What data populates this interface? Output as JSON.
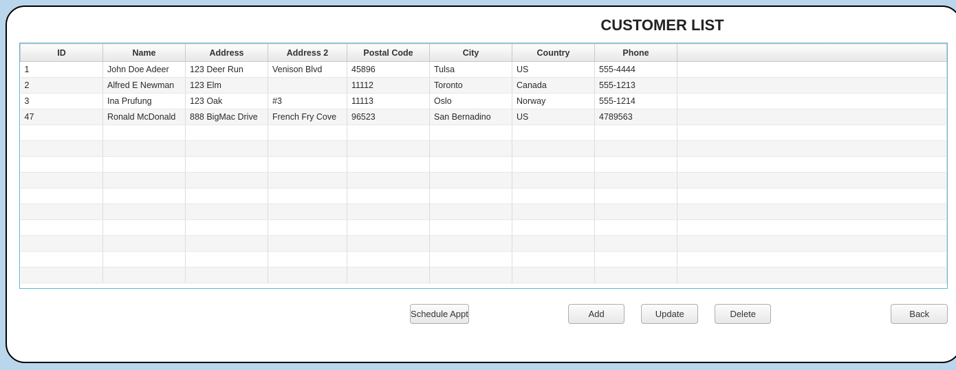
{
  "title": "CUSTOMER LIST",
  "columns": {
    "id": "ID",
    "name": "Name",
    "address": "Address",
    "address2": "Address 2",
    "postal": "Postal Code",
    "city": "City",
    "country": "Country",
    "phone": "Phone"
  },
  "rows": [
    {
      "id": "1",
      "name": "John Doe Adeer",
      "address": "123 Deer Run",
      "address2": "Venison Blvd",
      "postal": "45896",
      "city": "Tulsa",
      "country": "US",
      "phone": "555-4444"
    },
    {
      "id": "2",
      "name": "Alfred E Newman",
      "address": "123 Elm",
      "address2": "",
      "postal": "11112",
      "city": "Toronto",
      "country": "Canada",
      "phone": "555-1213"
    },
    {
      "id": "3",
      "name": "Ina Prufung",
      "address": "123 Oak",
      "address2": "#3",
      "postal": "11113",
      "city": "Oslo",
      "country": "Norway",
      "phone": "555-1214"
    },
    {
      "id": "47",
      "name": "Ronald McDonald",
      "address": "888 BigMac Drive",
      "address2": "French Fry Cove",
      "postal": "96523",
      "city": "San Bernadino",
      "country": "US",
      "phone": "4789563"
    }
  ],
  "empty_rows": 10,
  "buttons": {
    "schedule": "Schedule Appt",
    "add": "Add",
    "update": "Update",
    "delete": "Delete",
    "back": "Back"
  }
}
